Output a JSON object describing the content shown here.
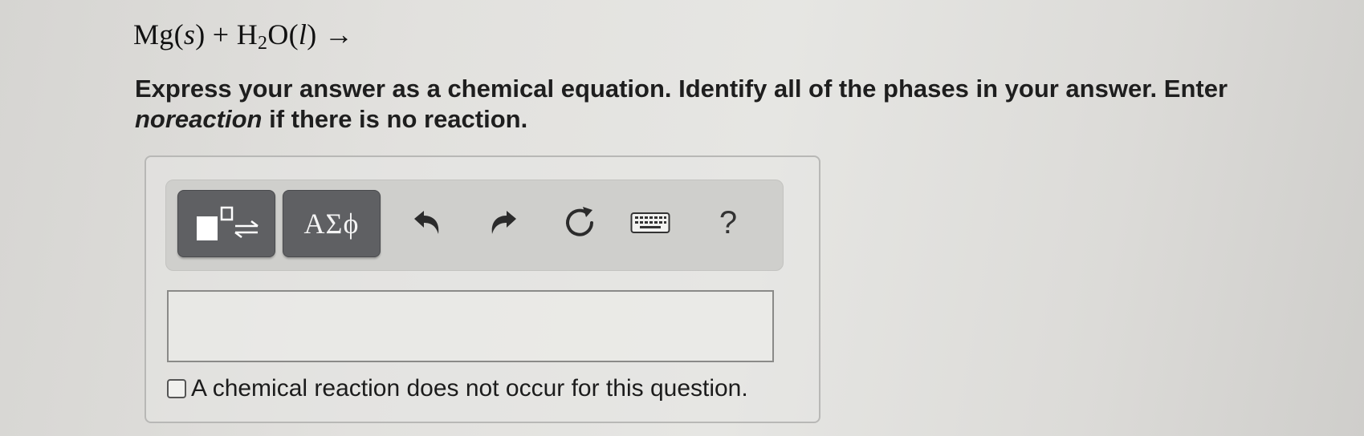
{
  "equation": {
    "left": "Mg(",
    "s_phase": "s",
    "middle": ") + H",
    "subscript": "2",
    "after_sub": "O(",
    "l_phase": "l",
    "end": ") →"
  },
  "instructions": {
    "main": "Express your answer as a chemical equation. Identify all of the phases in your answer. Enter ",
    "keyword": "noreaction",
    "tail": " if there is no reaction."
  },
  "toolbar": {
    "greek_label": "AΣϕ",
    "help_label": "?",
    "icons": [
      "templates-icon",
      "undo-icon",
      "redo-icon",
      "reset-icon",
      "keyboard-icon",
      "help-icon"
    ]
  },
  "answer": {
    "value": ""
  },
  "no_reaction": {
    "checked": false,
    "label": "A chemical reaction does not occur for this question."
  }
}
